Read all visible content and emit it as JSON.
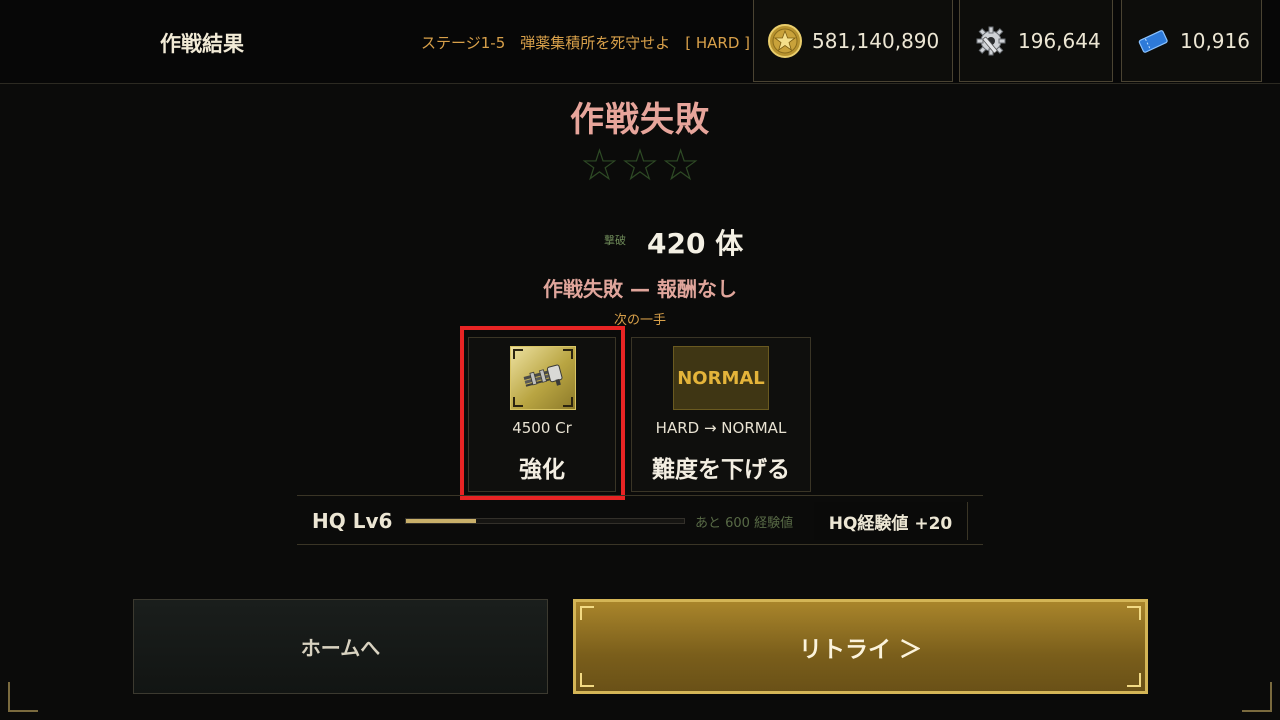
{
  "header": {
    "title": "作戦結果",
    "stage": "ステージ1-5　弾薬集積所を死守せよ　[ HARD ]"
  },
  "resources": {
    "gold": {
      "icon": "gold-star-coin-icon",
      "value": "581,140,890"
    },
    "gear": {
      "icon": "gear-wrench-icon",
      "value": "196,644"
    },
    "ticket": {
      "icon": "blue-ticket-icon",
      "value": "10,916"
    }
  },
  "result": {
    "title": "作戦失敗",
    "stars_earned": 0,
    "stars_total": 3,
    "kills_label": "撃破",
    "kills_value": "420 体",
    "reward_note": "作戦失敗 — 報酬なし",
    "next_label": "次の一手"
  },
  "options": [
    {
      "thumb_icon": "gatling-gun-icon",
      "sub": "4500 Cr",
      "label": "強化"
    },
    {
      "thumb_text": "NORMAL",
      "sub": "HARD → NORMAL",
      "label": "難度を下げる"
    }
  ],
  "hq": {
    "label": "HQ Lv6",
    "progress": 0.25,
    "remaining": "あと 600 経験値",
    "gain": "HQ経験値 +20"
  },
  "buttons": {
    "home": "ホームへ",
    "retry": "リトライ ＞"
  },
  "colors": {
    "accent_gold": "#c9a54a",
    "fail_pink": "#e7a59b",
    "highlight_red": "#e82424"
  }
}
